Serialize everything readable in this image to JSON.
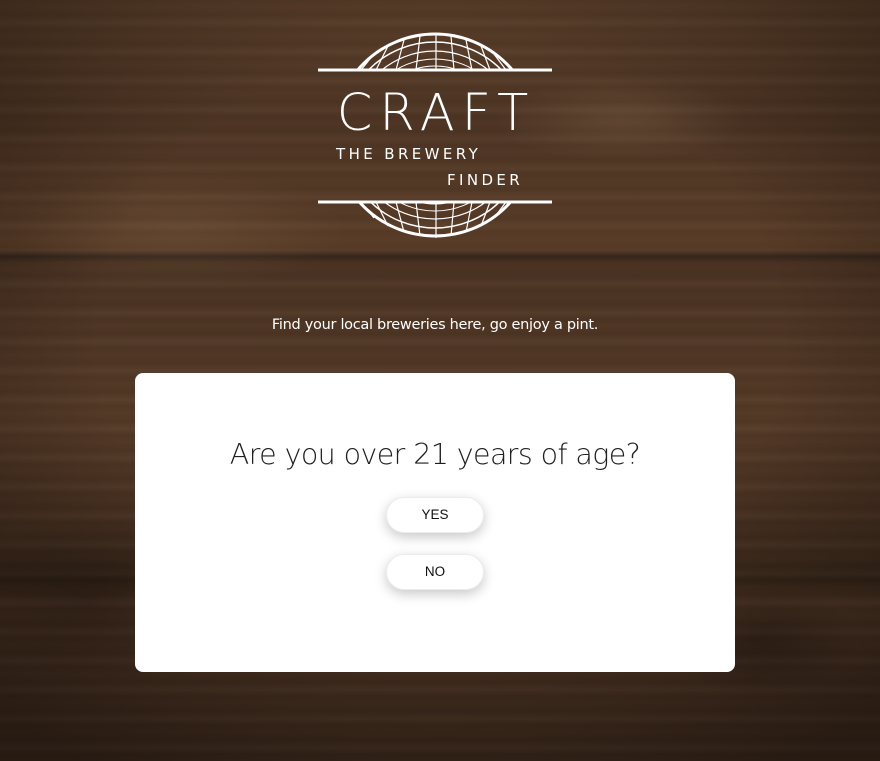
{
  "brand": {
    "title": "CRAFT",
    "subtitle_line1": "THE BREWERY",
    "subtitle_line2": "FINDER"
  },
  "tagline": "Find your local breweries here, go enjoy a pint.",
  "age_gate": {
    "question": "Are you over 21 years of age?",
    "yes_label": "YES",
    "no_label": "NO"
  },
  "colors": {
    "background_wood": "#4a3322",
    "logo_text": "#ffffff",
    "modal_background": "#ffffff",
    "question_text": "#1e1e1e"
  }
}
